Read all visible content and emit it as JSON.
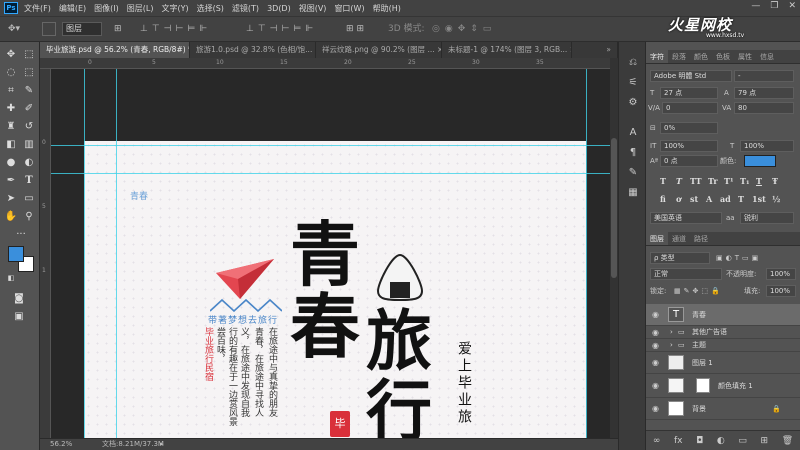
{
  "app_icon": "Ps",
  "menu": [
    "文件(F)",
    "编辑(E)",
    "图像(I)",
    "图层(L)",
    "文字(Y)",
    "选择(S)",
    "滤镜(T)",
    "3D(D)",
    "视图(V)",
    "窗口(W)",
    "帮助(H)"
  ],
  "window_controls": [
    "—",
    "❐",
    "✕"
  ],
  "options_bar": {
    "auto_select_target": "图层",
    "mode_3d": "3D 模式:"
  },
  "tabs": [
    {
      "label": "毕业旅游.psd @ 56.2% (青春, RGB/8#) *",
      "close": "×",
      "active": true
    },
    {
      "label": "旅游1.0.psd @ 32.8% (色相/饱...",
      "close": "×",
      "active": false
    },
    {
      "label": "祥云纹路.png @ 90.2% (图层 ...",
      "close": "×",
      "active": false
    },
    {
      "label": "未标题-1 @ 174% (图层 3, RGB...",
      "close": "×",
      "active": false
    }
  ],
  "ruler": {
    "h_ticks": [
      "0",
      "5",
      "10",
      "15",
      "20",
      "25",
      "30",
      "35"
    ],
    "v_ticks": [
      "0",
      "5",
      "1"
    ]
  },
  "status": {
    "zoom": "56.2%",
    "doc": "文档:8.21M/37.3M"
  },
  "watermark": {
    "logo": "火星网校",
    "url": "www.hxsd.tv"
  },
  "poster": {
    "small_title": "青春",
    "big_chars": [
      "青",
      "春",
      "旅",
      "行"
    ],
    "motto": "带著梦想去旅行",
    "body_cols": [
      "在旅途中与真挚的朋友",
      "青春，在旅途中寻找人",
      "义，在旅途中发现自我",
      "行的有趣在于一边赏风景",
      "尝百味，"
    ],
    "highlight": "毕业旅行民宿",
    "side_text": "爱上毕业旅",
    "seal": "毕"
  },
  "panel_tabs_top": [
    "字符",
    "段落",
    "颜色",
    "色板",
    "属性",
    "信息"
  ],
  "character": {
    "font_family": "Adobe 明體 Std",
    "font_style": "-",
    "size": "27 点",
    "leading": "79 点",
    "kerning": "0",
    "tracking": "80",
    "tsume": "0%",
    "vscale": "100%",
    "hscale": "100%",
    "baseline": "0 点",
    "color_label": "颜色:",
    "color": "#3a8fdc",
    "styles": [
      "T",
      "T",
      "TT",
      "Tr",
      "T¹",
      "T₁",
      "T",
      "Ŧ"
    ],
    "opentype": [
      "fi",
      "ơ",
      "st",
      "A",
      "ad",
      "T",
      "1st",
      "½"
    ],
    "language": "美国英语",
    "antialias": "锐利",
    "aa_prefix": "aa"
  },
  "panel_tabs_layers": [
    "图层",
    "通道",
    "路径"
  ],
  "layers_panel": {
    "filter": "ρ 类型",
    "blend": "正常",
    "opacity_label": "不透明度:",
    "opacity": "100%",
    "lock_label": "锁定:",
    "fill_label": "填充:",
    "fill": "100%",
    "layers": [
      {
        "name": "青春",
        "type": "text",
        "selected": true
      },
      {
        "name": "其他广告语",
        "type": "group",
        "selected": false
      },
      {
        "name": "主题",
        "type": "group",
        "selected": false
      },
      {
        "name": "图层 1",
        "type": "pixel",
        "selected": false
      },
      {
        "name": "颜色填充 1",
        "type": "fill",
        "selected": false
      },
      {
        "name": "背景",
        "type": "background",
        "selected": false
      }
    ],
    "footer_icons": [
      "link-icon",
      "fx-icon",
      "mask-icon",
      "adjustment-icon",
      "folder-icon",
      "new-layer-icon",
      "trash-icon"
    ]
  },
  "colors": {
    "foreground": "#3a8fdc",
    "background": "#ffffff",
    "accent_red": "#d9303a"
  }
}
